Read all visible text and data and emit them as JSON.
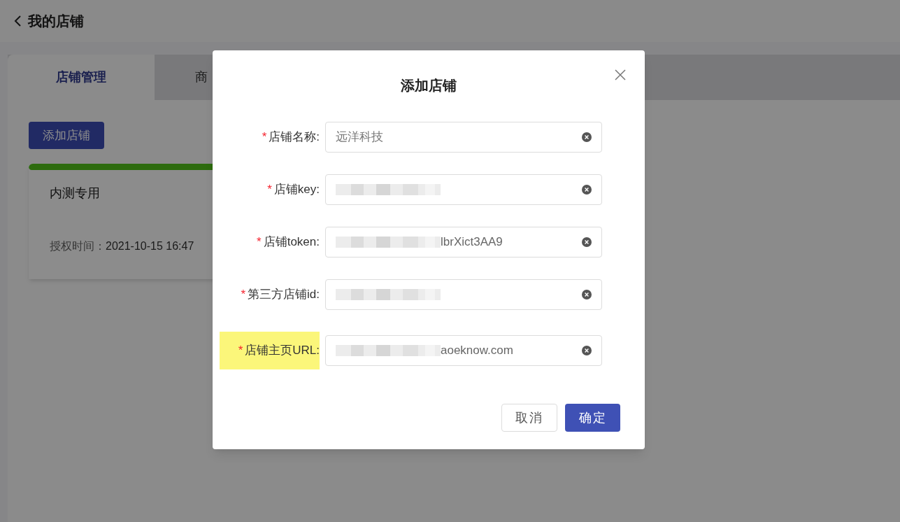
{
  "header": {
    "title": "我的店铺"
  },
  "tabs": [
    {
      "label": "店铺管理",
      "selected": true
    },
    {
      "label": "商",
      "selected": false
    }
  ],
  "add_button": "添加店铺",
  "shop_card": {
    "title": "内测专用",
    "auth_label": "授权时间：",
    "auth_time": "2021-10-15 16:47"
  },
  "dialog": {
    "title": "添加店铺",
    "fields": [
      {
        "label": "店铺名称:",
        "required_mark": "*",
        "highlighted": false,
        "value": "远洋科技",
        "redacted": false
      },
      {
        "label": "店铺key:",
        "required_mark": "*",
        "highlighted": false,
        "redacted": true
      },
      {
        "label": "店铺token:",
        "required_mark": "*",
        "highlighted": false,
        "value": "lbrXict3AA9",
        "redacted": true
      },
      {
        "label": "第三方店铺id:",
        "required_mark": "*",
        "highlighted": false,
        "redacted": true
      },
      {
        "label": "店铺主页URL:",
        "required_mark": "*",
        "highlighted": true,
        "value": "aoeknow.com",
        "redacted": true
      }
    ],
    "buttons": [
      {
        "label": "取消",
        "kind": "secondary"
      },
      {
        "label": "确定",
        "kind": "primary"
      }
    ]
  }
}
